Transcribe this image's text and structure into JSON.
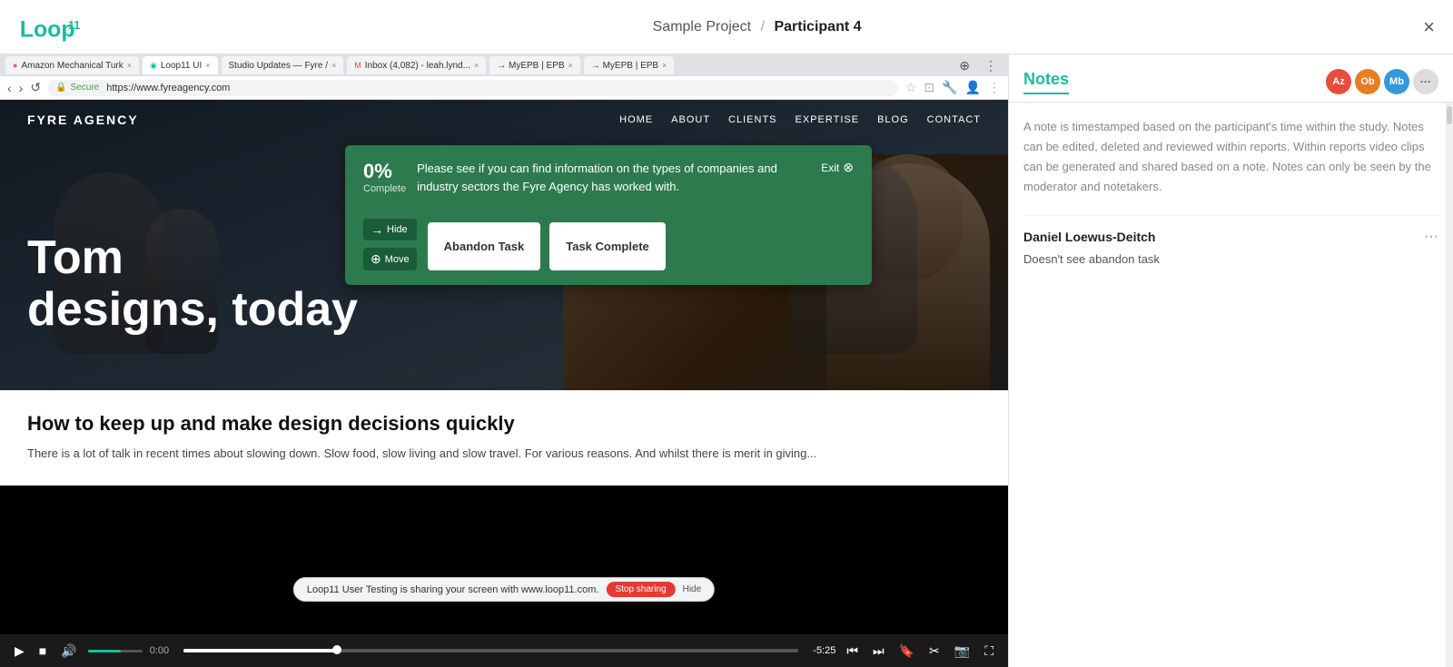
{
  "topbar": {
    "project": "Sample Project",
    "separator": "/",
    "participant": "Participant 4",
    "close_label": "×"
  },
  "browser": {
    "tabs": [
      {
        "label": "Amazon Mechanical Turk",
        "active": false
      },
      {
        "label": "Loop11 UI",
        "active": false
      },
      {
        "label": "Studio Updates — Fyre /",
        "active": false
      },
      {
        "label": "Inbox (4,082) - leah.lynd...",
        "active": false
      },
      {
        "label": "MyEPB | EPB",
        "active": false
      },
      {
        "label": "MyEPB | EPB",
        "active": false
      }
    ],
    "address": "https://www.fyreagency.com",
    "secure_label": "Secure"
  },
  "fyre": {
    "logo": "FYRE AGENCY",
    "nav_items": [
      "HOME",
      "ABOUT",
      "CLIENTS",
      "EXPERTISE",
      "BLOG",
      "CONTACT"
    ],
    "hero_text": "Tom\ndesigns, today"
  },
  "task_overlay": {
    "percent": "0%",
    "complete_label": "Complete",
    "exit_label": "Exit",
    "description": "Please see if you can find information on the types of companies and industry sectors the Fyre Agency has worked with.",
    "hide_label": "Hide",
    "move_label": "Move",
    "abandon_label": "Abandon Task",
    "complete_btn_label": "Task Complete"
  },
  "website_lower": {
    "heading": "How to keep up and make design decisions quickly",
    "body": "There is a lot of talk in recent times about slowing down. Slow food, slow living and slow travel. For various reasons. And whilst there is merit in giving..."
  },
  "share_bar": {
    "text": "Loop11 User Testing is sharing your screen with www.loop11.com.",
    "stop_label": "Stop sharing",
    "hide_label": "Hide"
  },
  "video_controls": {
    "time_remaining": "-5:25"
  },
  "notes": {
    "title": "Notes",
    "avatars": [
      "Az",
      "Ob",
      "Mb"
    ],
    "more_label": "···",
    "hint": "A note is timestamped based on the participant's time within the study. Notes can be edited, deleted and reviewed within reports. Within reports video clips can be generated and shared based on a note. Notes can only be seen by the moderator and notetakers.",
    "author": "Daniel Loewus-Deitch",
    "menu_label": "···",
    "note_text": "Doesn't see abandon task"
  }
}
